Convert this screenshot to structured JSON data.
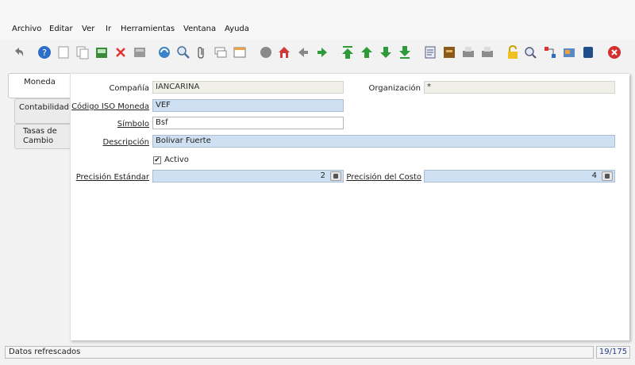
{
  "menu": {
    "archivo": "Archivo",
    "editar": "Editar",
    "ver": "Ver",
    "ir": "Ir",
    "herramientas": "Herramientas",
    "ventana": "Ventana",
    "ayuda": "Ayuda"
  },
  "toolbar": {
    "icons": [
      "undo-icon",
      "help-icon",
      "new-record-icon",
      "copy-record-icon",
      "save-icon",
      "delete-icon",
      "print-preview-icon",
      "refresh-icon",
      "find-icon",
      "attachment-icon",
      "chat-icon",
      "grid-toggle-icon",
      "history-icon",
      "home-icon",
      "previous-icon",
      "next-icon",
      "first-record-icon",
      "parent-icon",
      "child-icon",
      "last-record-icon",
      "report-icon",
      "archive-icon",
      "print-icon",
      "print-preview2-icon",
      "lock-icon",
      "zoom-across-icon",
      "workflow-icon",
      "product-info-icon",
      "calendar-icon",
      "close-window-icon"
    ]
  },
  "tabs": [
    {
      "label": "Moneda",
      "active": true
    },
    {
      "label": "Contabilidad",
      "active": false
    },
    {
      "label": "Tasas de Cambio",
      "active": false
    }
  ],
  "form": {
    "company_label": "Compañía",
    "company_value": "IANCARINA",
    "org_label": "Organización",
    "org_value": "*",
    "iso_label": "Código ISO Moneda",
    "iso_value": "VEF",
    "symbol_label": "Símbolo",
    "symbol_value": "Bsf",
    "desc_label": "Descripción",
    "desc_value": "Bolivar Fuerte",
    "active_label": "Activo",
    "active_checked": "✔",
    "std_prec_label": "Precisión Estándar",
    "std_prec_value": "2",
    "cost_prec_label": "Precisión del Costo",
    "cost_prec_value": "4"
  },
  "status": {
    "message": "Datos refrescados",
    "record_count": "19/175"
  },
  "colors": {
    "required": "#cfe0f3",
    "readonly": "#f0f0e8",
    "accent": "#1f3e8a"
  }
}
